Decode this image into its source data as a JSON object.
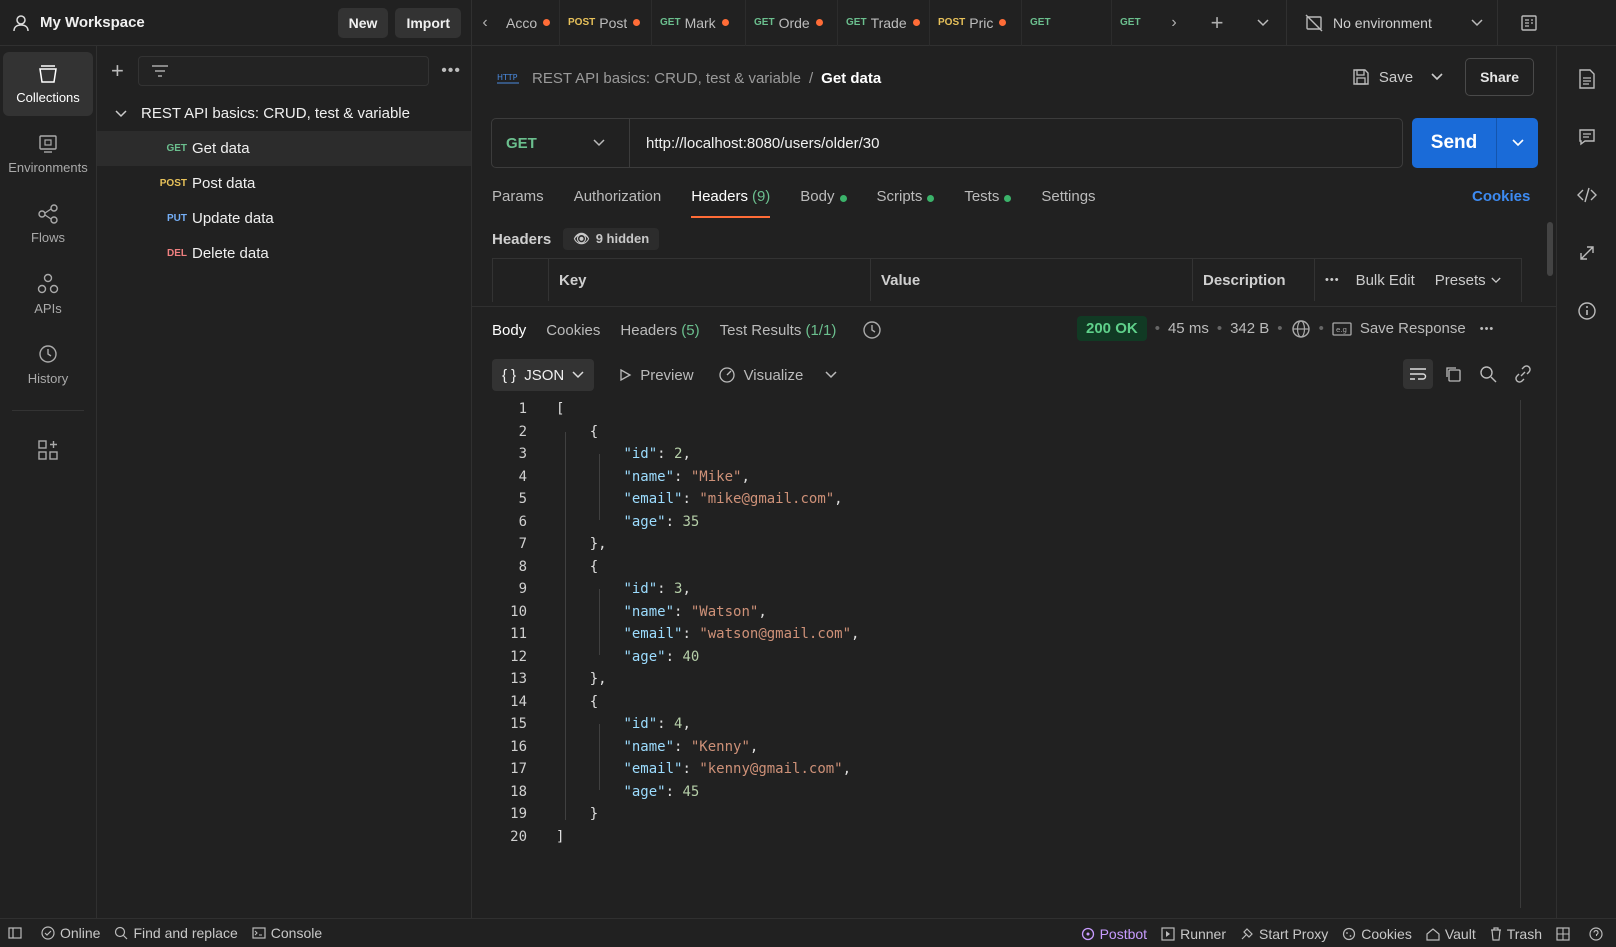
{
  "workspace": {
    "name": "My Workspace",
    "new_label": "New",
    "import_label": "Import"
  },
  "tabs": [
    {
      "method": "",
      "label": "Acco",
      "dirty": true
    },
    {
      "method": "POST",
      "label": "Post",
      "dirty": true
    },
    {
      "method": "GET",
      "label": "Mark",
      "dirty": true
    },
    {
      "method": "GET",
      "label": "Orde",
      "dirty": true
    },
    {
      "method": "GET",
      "label": "Trade",
      "dirty": true
    },
    {
      "method": "POST",
      "label": "Pric",
      "dirty": true
    },
    {
      "method": "GET",
      "label": "",
      "dirty": false
    },
    {
      "method": "GET",
      "label": "",
      "dirty": false
    }
  ],
  "environment": {
    "label": "No environment"
  },
  "rail": [
    {
      "label": "Collections",
      "icon": "collections-icon",
      "active": true
    },
    {
      "label": "Environments",
      "icon": "environments-icon",
      "active": false
    },
    {
      "label": "Flows",
      "icon": "flows-icon",
      "active": false
    },
    {
      "label": "APIs",
      "icon": "apis-icon",
      "active": false
    },
    {
      "label": "History",
      "icon": "history-icon",
      "active": false
    }
  ],
  "collection": {
    "name": "REST API basics: CRUD, test & variable",
    "requests": [
      {
        "method": "GET",
        "label": "Get data",
        "selected": true
      },
      {
        "method": "POST",
        "label": "Post data",
        "selected": false
      },
      {
        "method": "PUT",
        "label": "Update data",
        "selected": false
      },
      {
        "method": "DEL",
        "label": "Delete data",
        "selected": false
      }
    ]
  },
  "request": {
    "breadcrumb_parent": "REST API basics: CRUD, test & variable",
    "breadcrumb_sep": "/",
    "breadcrumb_current": "Get data",
    "save_label": "Save",
    "share_label": "Share",
    "method": "GET",
    "url": "http://localhost:8080/users/older/30",
    "send_label": "Send",
    "tabs": [
      {
        "label": "Params",
        "count": "",
        "dot": false
      },
      {
        "label": "Authorization",
        "count": "",
        "dot": false
      },
      {
        "label": "Headers",
        "count": "(9)",
        "dot": false,
        "active": true
      },
      {
        "label": "Body",
        "count": "",
        "dot": true
      },
      {
        "label": "Scripts",
        "count": "",
        "dot": true
      },
      {
        "label": "Tests",
        "count": "",
        "dot": true
      },
      {
        "label": "Settings",
        "count": "",
        "dot": false
      }
    ],
    "cookies_label": "Cookies",
    "headers_title": "Headers",
    "hidden_label": "9 hidden",
    "columns": {
      "key": "Key",
      "value": "Value",
      "description": "Description",
      "bulk_edit": "Bulk Edit",
      "presets": "Presets"
    }
  },
  "response": {
    "tabs": {
      "body": "Body",
      "cookies": "Cookies",
      "headers": "Headers",
      "headers_count": "(5)",
      "tests": "Test Results",
      "tests_count": "(1/1)"
    },
    "status": "200 OK",
    "time": "45 ms",
    "size": "342 B",
    "save_label": "Save Response",
    "format": "JSON",
    "preview_label": "Preview",
    "visualize_label": "Visualize",
    "body_lines": [
      "[",
      "    {",
      "        \"id\": 2,",
      "        \"name\": \"Mike\",",
      "        \"email\": \"mike@gmail.com\",",
      "        \"age\": 35",
      "    },",
      "    {",
      "        \"id\": 3,",
      "        \"name\": \"Watson\",",
      "        \"email\": \"watson@gmail.com\",",
      "        \"age\": 40",
      "    },",
      "    {",
      "        \"id\": 4,",
      "        \"name\": \"Kenny\",",
      "        \"email\": \"kenny@gmail.com\",",
      "        \"age\": 45",
      "    }",
      "]"
    ]
  },
  "footer": {
    "online": "Online",
    "find_replace": "Find and replace",
    "console": "Console",
    "postbot": "Postbot",
    "runner": "Runner",
    "proxy": "Start Proxy",
    "cookies": "Cookies",
    "vault": "Vault",
    "trash": "Trash"
  }
}
